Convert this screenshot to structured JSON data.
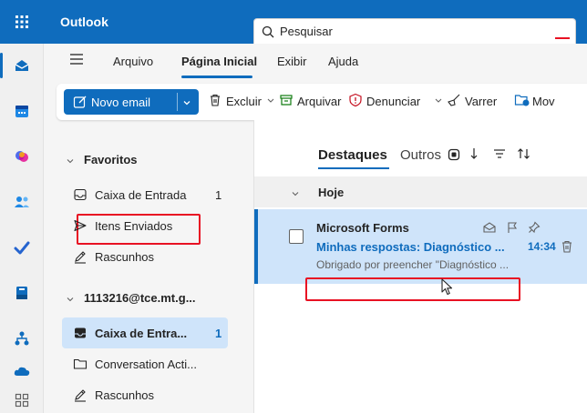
{
  "app": {
    "title": "Outlook"
  },
  "search": {
    "placeholder": "Pesquisar"
  },
  "menu": {
    "items": [
      "Arquivo",
      "Página Inicial",
      "Exibir",
      "Ajuda"
    ],
    "selected": "Página Inicial"
  },
  "ribbon": {
    "new_email": "Novo email",
    "delete": "Excluir",
    "archive": "Arquivar",
    "report": "Denunciar",
    "sweep": "Varrer",
    "move": "Mov"
  },
  "folders": {
    "favorites_label": "Favoritos",
    "favorites": [
      {
        "label": "Caixa de Entrada",
        "count": "1"
      },
      {
        "label": "Itens Enviados"
      },
      {
        "label": "Rascunhos"
      }
    ],
    "account_label": "1113216@tce.mt.g...",
    "account_items": [
      {
        "label": "Caixa de Entra...",
        "count": "1"
      },
      {
        "label": "Conversation Acti..."
      },
      {
        "label": "Rascunhos"
      }
    ]
  },
  "list": {
    "tabs": [
      "Destaques",
      "Outros"
    ],
    "group_label": "Hoje",
    "messages": [
      {
        "sender": "Microsoft Forms",
        "subject": "Minhas respostas: Diagnóstico ...",
        "time": "14:34",
        "preview": "Obrigado por preencher \"Diagnóstico ..."
      }
    ]
  },
  "colors": {
    "accent": "#0f6cbd",
    "selected_bg": "#cfe4fa",
    "highlight_box": "#e81123"
  }
}
